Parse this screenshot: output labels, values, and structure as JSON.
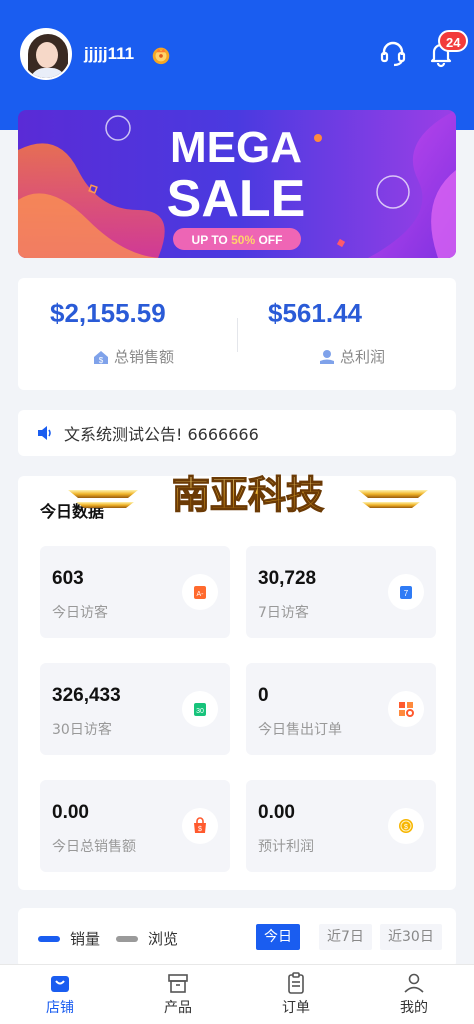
{
  "header": {
    "username": "jjjjj111",
    "notification_count": "24"
  },
  "banner": {
    "line1": "MEGA",
    "line2": "SALE",
    "offer_prefix": "UP TO ",
    "offer_highlight": "50%",
    "offer_suffix": " OFF"
  },
  "sales": {
    "total_sales_value": "$2,155.59",
    "total_sales_label": "总销售额",
    "total_profit_value": "$561.44",
    "total_profit_label": "总利润"
  },
  "notice": {
    "text": "文系统测试公告! 6666666"
  },
  "today": {
    "title": "今日数据",
    "brand": "南亚科技",
    "stats": [
      {
        "value": "603",
        "label": "今日访客",
        "icon": "calendar-a-icon",
        "color": "#ff6a2e"
      },
      {
        "value": "30,728",
        "label": "7日访客",
        "icon": "calendar-7-icon",
        "color": "#2f7bf5"
      },
      {
        "value": "326,433",
        "label": "30日访客",
        "icon": "calendar-30-icon",
        "color": "#17c37b"
      },
      {
        "value": "0",
        "label": "今日售出订单",
        "icon": "grid-search-icon",
        "color": "#ff5a2e"
      },
      {
        "value": "0.00",
        "label": "今日总销售额",
        "icon": "shopping-bag-icon",
        "color": "#ff5a2e"
      },
      {
        "value": "0.00",
        "label": "预计利润",
        "icon": "coin-icon",
        "color": "#f7b500"
      }
    ]
  },
  "chart": {
    "legend": [
      {
        "label": "销量",
        "color": "#1a5df0"
      },
      {
        "label": "浏览",
        "color": "#9a9a9a"
      }
    ],
    "ranges": [
      "今日",
      "近7日",
      "近30日"
    ],
    "active_range": "今日"
  },
  "tabbar": {
    "items": [
      {
        "label": "店铺",
        "icon": "shop-bag-icon"
      },
      {
        "label": "产品",
        "icon": "box-icon"
      },
      {
        "label": "订单",
        "icon": "clipboard-icon"
      },
      {
        "label": "我的",
        "icon": "person-icon"
      }
    ],
    "active": "店铺"
  }
}
